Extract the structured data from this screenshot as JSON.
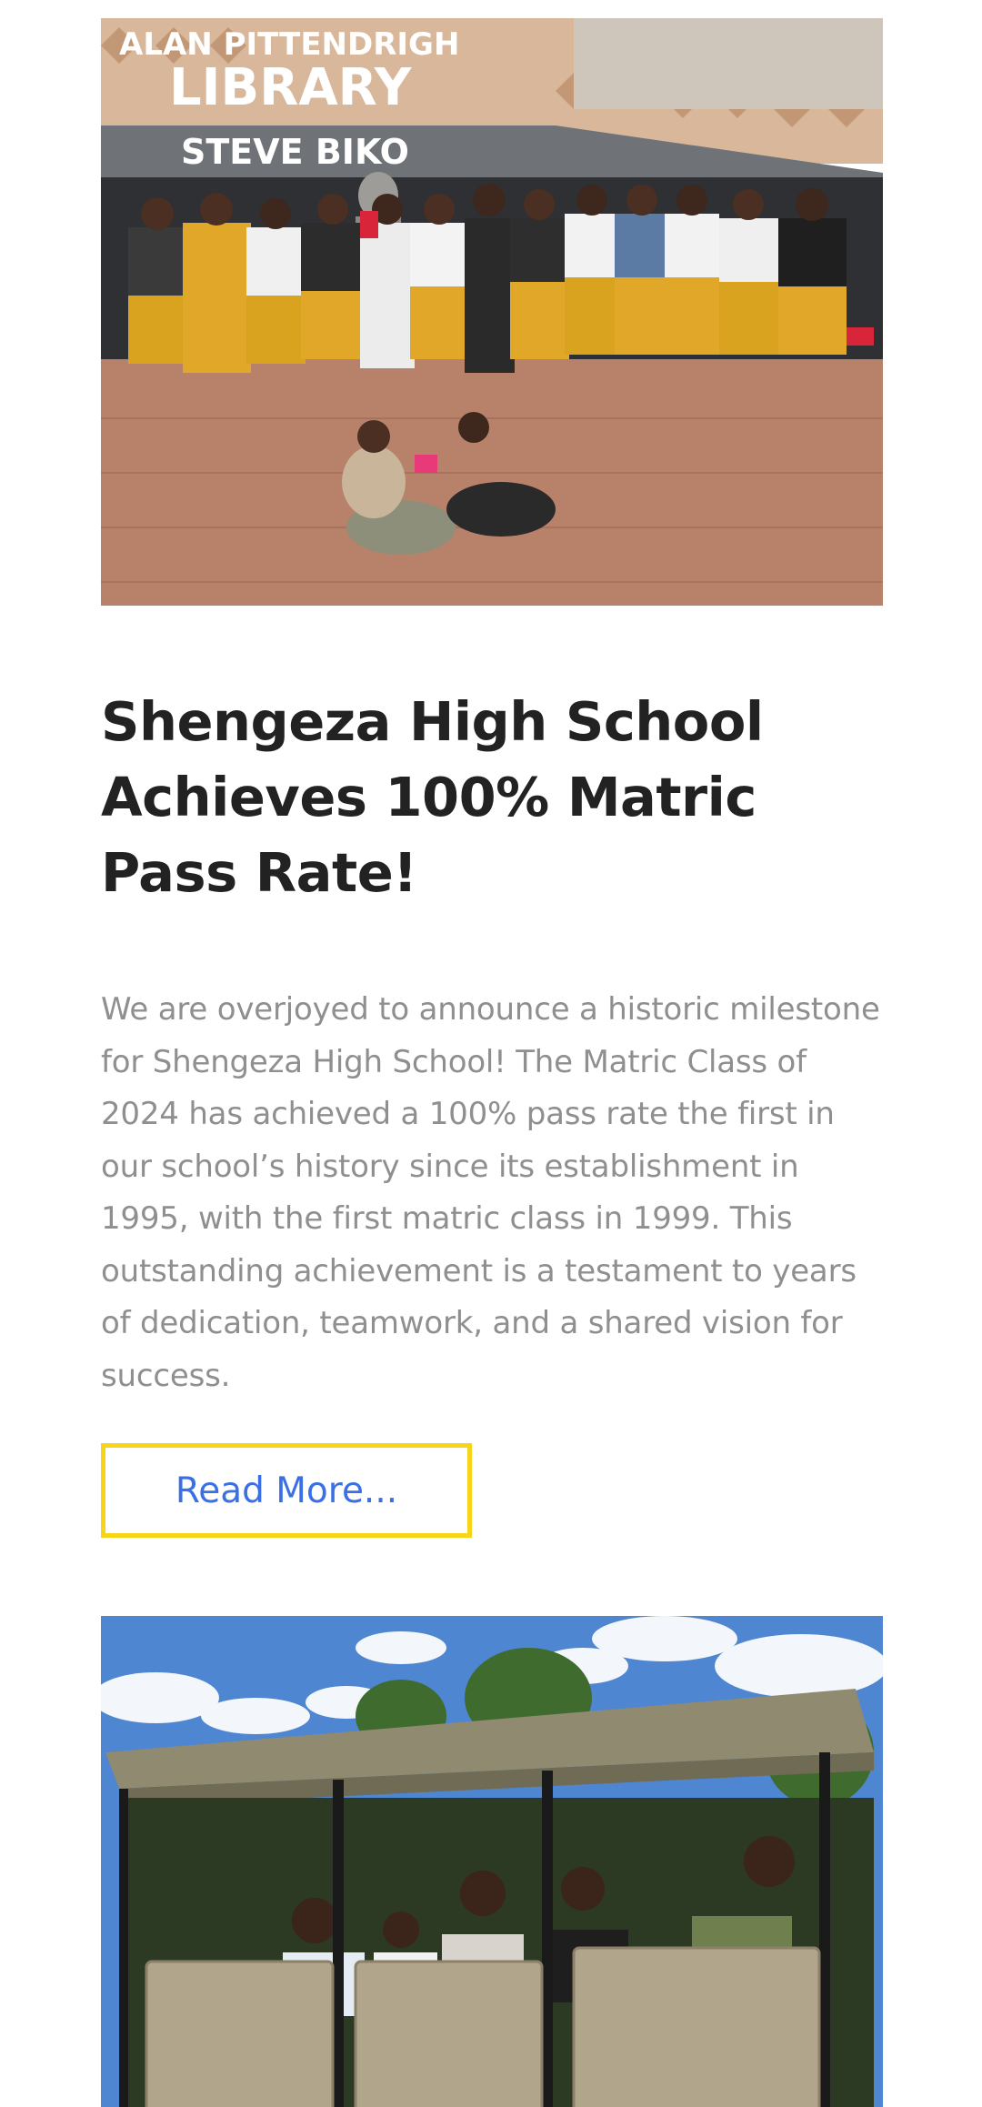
{
  "post": {
    "image_alt": "Students posing outside the Alan Pittendrigh Library, Steve Biko",
    "sign_line1": "ALAN PITTENDRIGH",
    "sign_line2": "LIBRARY",
    "sign_line3": "STEVE BIKO",
    "title": "Shengeza High School Achieves 100% Matric Pass Rate!",
    "excerpt": "We are overjoyed to announce a historic milestone for Shengeza High School! The Matric Class of 2024 has achieved a 100% pass rate the first in our school’s history since its establishment in 1995, with the first matric class in 1999. This outstanding achievement is a testament to years of dedication, teamwork, and a shared vision for success.",
    "read_more_label": "Read More..."
  },
  "next_post": {
    "image_alt": "Group of people on a safari game-drive vehicle"
  },
  "colors": {
    "title": "#222222",
    "excerpt": "#8f8f8f",
    "button_text": "#3a6fe6",
    "button_border": "#f7d417"
  }
}
